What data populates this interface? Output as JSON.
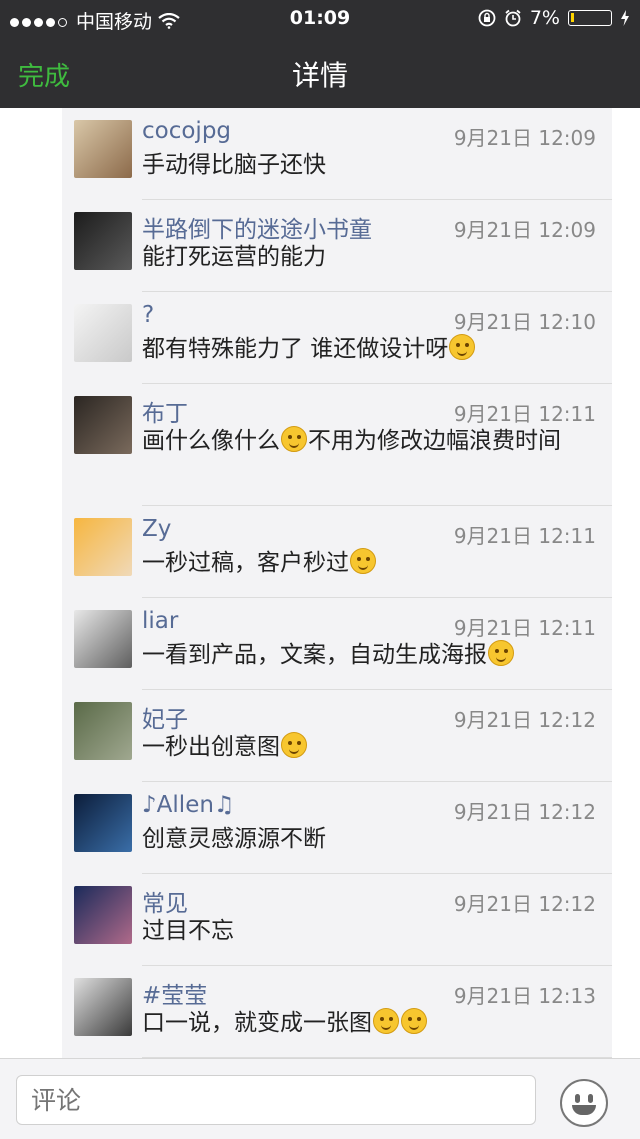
{
  "status_bar": {
    "carrier": "中国移动",
    "time": "01:09",
    "battery": "7%",
    "battery_level": 0.07,
    "icons": [
      "signal-dots-icon",
      "wifi-icon",
      "rotation-lock-icon",
      "alarm-icon",
      "battery-icon",
      "charging-icon"
    ]
  },
  "nav": {
    "done_label": "完成",
    "title": "详情",
    "accent_color": "#3fbb3f"
  },
  "comments": [
    {
      "name": "cocojpg",
      "time": "9月21日 12:09",
      "text": "手动得比脑子还快",
      "emojis": 0
    },
    {
      "name": "半路倒下的迷途小书童",
      "time": "9月21日 12:09",
      "text": "能打死运营的能力",
      "emojis": 0
    },
    {
      "name": "?",
      "time": "9月21日 12:10",
      "text": "都有特殊能力了 谁还做设计呀",
      "emojis": 1
    },
    {
      "name": "布丁",
      "time": "9月21日 12:11",
      "text": "画什么像什么",
      "emojis": 1,
      "text_after": "不用为修改边幅浪费时间"
    },
    {
      "name": "Zy",
      "time": "9月21日 12:11",
      "text": "一秒过稿，客户秒过",
      "emojis": 1
    },
    {
      "name": "liar",
      "time": "9月21日 12:11",
      "text": "一看到产品，文案，自动生成海报",
      "emojis": 1
    },
    {
      "name": "妃子",
      "time": "9月21日 12:12",
      "text": "一秒出创意图",
      "emojis": 1
    },
    {
      "name": "♪Allen♫",
      "time": "9月21日 12:12",
      "text": "创意灵感源源不断",
      "emojis": 0
    },
    {
      "name": "常见",
      "time": "9月21日 12:12",
      "text": "过目不忘",
      "emojis": 0
    },
    {
      "name": "#莹莹",
      "time": "9月21日 12:13",
      "text": "口一说，就变成一张图",
      "emojis": 2
    }
  ],
  "comment_box": {
    "placeholder": "评论"
  }
}
